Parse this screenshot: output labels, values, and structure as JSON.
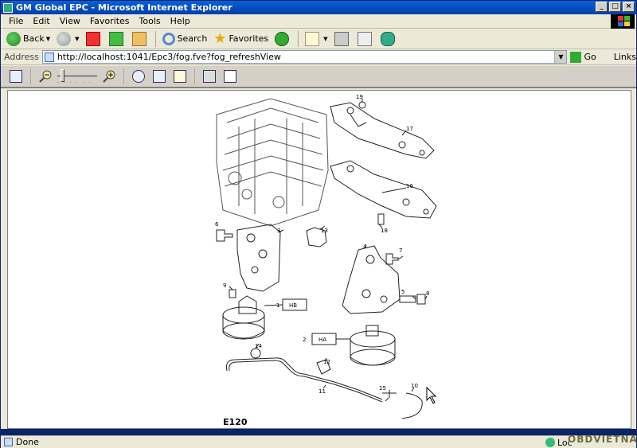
{
  "window": {
    "title": "GM Global EPC - Microsoft Internet Explorer"
  },
  "menubar": {
    "items": [
      "File",
      "Edit",
      "View",
      "Favorites",
      "Tools",
      "Help"
    ]
  },
  "toolbar": {
    "back_label": "Back",
    "search_label": "Search",
    "favorites_label": "Favorites"
  },
  "addressbar": {
    "label": "Address",
    "url": "http://localhost:1041/Epc3/fog.fve?fog_refreshView",
    "go_label": "Go",
    "links_label": "Links"
  },
  "diagram": {
    "code": "E120",
    "callouts": [
      "19",
      "17",
      "16",
      "18",
      "6",
      "3",
      "13",
      "4",
      "7",
      "5",
      "8",
      "9",
      "1",
      "HB",
      "2",
      "HA",
      "14",
      "12",
      "11",
      "15",
      "10"
    ]
  },
  "statusbar": {
    "text": "Done",
    "zone_label": "Loc",
    "watermark": "OBDVIETNAM"
  },
  "icons": {
    "back": "back-arrow-icon",
    "forward": "forward-arrow-icon",
    "stop": "stop-icon",
    "refresh": "refresh-icon",
    "home": "home-icon",
    "search": "search-icon",
    "favorites": "star-icon",
    "media": "media-icon",
    "mail": "mail-icon",
    "print": "print-icon",
    "edit": "edit-icon",
    "messenger": "messenger-icon"
  },
  "colors": {
    "titlebar": "#0a5fd8",
    "chrome": "#ece9d8",
    "content_bg": "#ffffff"
  }
}
